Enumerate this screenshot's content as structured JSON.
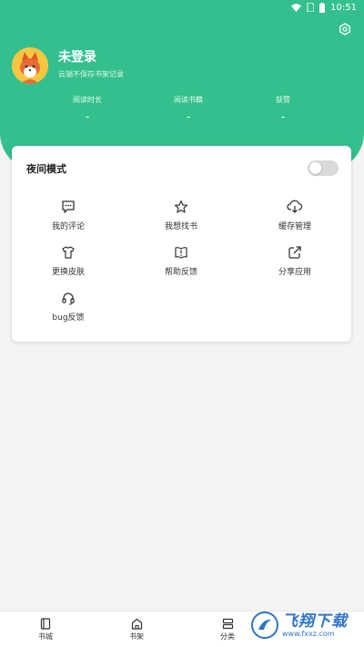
{
  "status_bar": {
    "time": "10:51"
  },
  "profile": {
    "username": "未登录",
    "subtitle": "云端不保存书架记录"
  },
  "stats": [
    {
      "label": "阅读时长",
      "value": "-"
    },
    {
      "label": "阅读书籍",
      "value": "-"
    },
    {
      "label": "获赞",
      "value": "-"
    }
  ],
  "night_mode": {
    "label": "夜间模式",
    "enabled": false
  },
  "menu": [
    {
      "label": "我的评论",
      "icon": "comment-icon"
    },
    {
      "label": "我想找书",
      "icon": "star-icon"
    },
    {
      "label": "缓存管理",
      "icon": "cloud-download-icon"
    },
    {
      "label": "更换皮肤",
      "icon": "shirt-icon"
    },
    {
      "label": "帮助反馈",
      "icon": "help-book-icon"
    },
    {
      "label": "分享应用",
      "icon": "share-icon"
    },
    {
      "label": "bug反馈",
      "icon": "headset-icon"
    }
  ],
  "bottom_nav": [
    {
      "label": "书城",
      "icon": "bookstore-icon"
    },
    {
      "label": "书架",
      "icon": "bookshelf-icon"
    },
    {
      "label": "分类",
      "icon": "category-icon"
    }
  ],
  "watermark": {
    "text": "飞翔下载",
    "url": "www.fxxz.com"
  },
  "colors": {
    "accent": "#34c08e",
    "toggle_off": "#d9d9d9"
  }
}
